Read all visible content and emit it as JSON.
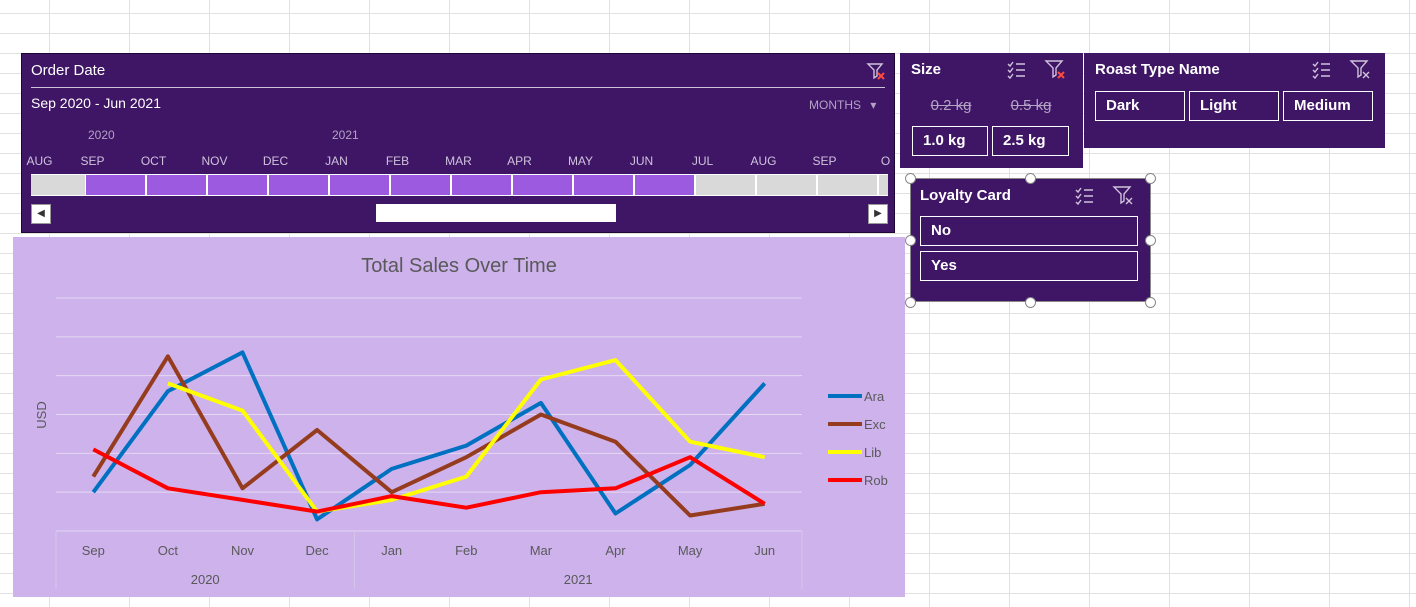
{
  "timeline": {
    "title": "Order Date",
    "range": "Sep 2020 - Jun 2021",
    "level": "MONTHS",
    "years": [
      {
        "label": "2020"
      },
      {
        "label": "2021"
      }
    ],
    "months": [
      "AUG",
      "SEP",
      "OCT",
      "NOV",
      "DEC",
      "JAN",
      "FEB",
      "MAR",
      "APR",
      "MAY",
      "JUN",
      "JUL",
      "AUG",
      "SEP",
      "O"
    ],
    "selected_from": "SEP",
    "selected_to": "JUN"
  },
  "size_slicer": {
    "title": "Size",
    "items": [
      {
        "label": "0.2 kg",
        "selected": false
      },
      {
        "label": "0.5 kg",
        "selected": false
      },
      {
        "label": "1.0 kg",
        "selected": true
      },
      {
        "label": "2.5 kg",
        "selected": true
      }
    ]
  },
  "roast_slicer": {
    "title": "Roast Type Name",
    "items": [
      {
        "label": "Dark",
        "selected": true
      },
      {
        "label": "Light",
        "selected": true
      },
      {
        "label": "Medium",
        "selected": true
      }
    ]
  },
  "loyalty_slicer": {
    "title": "Loyalty Card",
    "items": [
      {
        "label": "No",
        "selected": true
      },
      {
        "label": "Yes",
        "selected": true
      }
    ]
  },
  "colors": {
    "slicer_bg": "#3f1566",
    "timeline_selected": "#9b5ae0",
    "chart_bg": "#cdb2ec"
  },
  "chart_data": {
    "type": "line",
    "title": "Total Sales Over Time",
    "ylabel": "USD",
    "xlabel": "",
    "categories": [
      "Sep",
      "Oct",
      "Nov",
      "Dec",
      "Jan",
      "Feb",
      "Mar",
      "Apr",
      "May",
      "Jun"
    ],
    "groups": [
      {
        "label": "2020",
        "count": 4
      },
      {
        "label": "2021",
        "count": 6
      }
    ],
    "ylim": [
      0,
      6
    ],
    "grid": true,
    "legend": "right",
    "series": [
      {
        "name": "Ara",
        "color": "#0070c0",
        "values": [
          1.0,
          3.6,
          4.6,
          0.3,
          1.6,
          2.2,
          3.3,
          0.45,
          1.7,
          3.8
        ]
      },
      {
        "name": "Exc",
        "color": "#963c1e",
        "values": [
          1.4,
          4.5,
          1.1,
          2.6,
          1.0,
          1.9,
          3.0,
          2.3,
          0.4,
          0.7
        ]
      },
      {
        "name": "Lib",
        "color": "#ffff00",
        "values": [
          null,
          3.8,
          3.1,
          0.5,
          0.8,
          1.4,
          3.9,
          4.4,
          2.3,
          1.9
        ]
      },
      {
        "name": "Rob",
        "color": "#ff0000",
        "values": [
          2.1,
          1.1,
          0.8,
          0.5,
          0.9,
          0.6,
          1.0,
          1.1,
          1.9,
          0.7
        ]
      }
    ]
  }
}
